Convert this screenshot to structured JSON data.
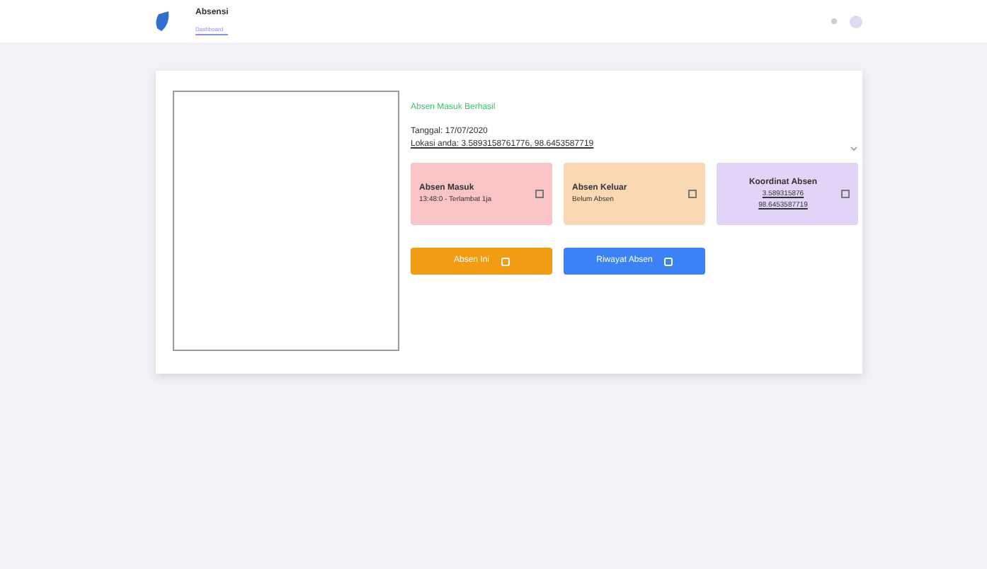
{
  "navbar": {
    "title": "Absensi",
    "subtitle": "Dashboard"
  },
  "status_message": "Absen Masuk Berhasil",
  "date": "Tanggal: 17/07/2020",
  "location": "Lokasi anda: 3.5893158761776, 98.6453587719",
  "info_cards": [
    {
      "title": "Absen Masuk",
      "lines": [
        "13:48:0 - Terlambat 1ja"
      ],
      "color": "#f8c4c6"
    },
    {
      "title": "Absen Keluar",
      "lines": [
        "Belum Absen"
      ],
      "color": "#f9d8b3"
    },
    {
      "title": "Koordinat Absen",
      "lines": [
        "3.589315876",
        "98.6453587719"
      ],
      "color": "#e2d4f7"
    }
  ],
  "buttons": [
    {
      "label": "Absen Ini",
      "color": "#f39c12"
    },
    {
      "label": "Riwayat Absen",
      "color": "#3b82f6"
    }
  ]
}
